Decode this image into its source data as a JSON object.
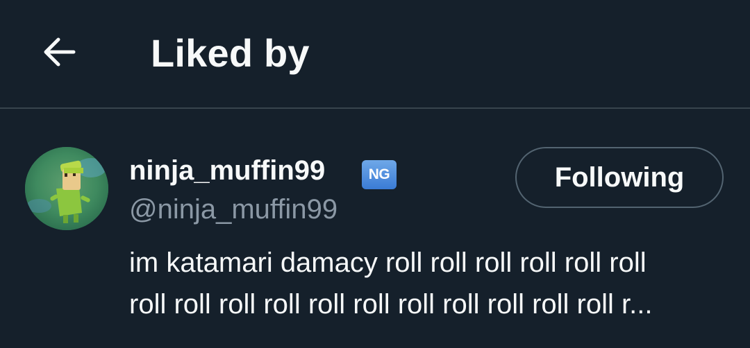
{
  "header": {
    "back_icon": "arrow-left-icon",
    "title": "Liked by"
  },
  "user": {
    "display_name": "ninja_muffin99",
    "badge_emoji": "🆖",
    "badge_text": "NG",
    "handle": "@ninja_muffin99",
    "follow_button_label": "Following",
    "bio_line1": "im katamari damacy roll roll roll roll roll roll",
    "bio_line2": "roll roll roll roll roll roll roll roll roll roll roll r..."
  },
  "colors": {
    "background": "#15202b",
    "divider": "#38444d",
    "text_primary": "#f7f9f9",
    "text_secondary": "#8b98a5",
    "button_border": "#536471",
    "badge_blue": "#3a7bd5"
  }
}
